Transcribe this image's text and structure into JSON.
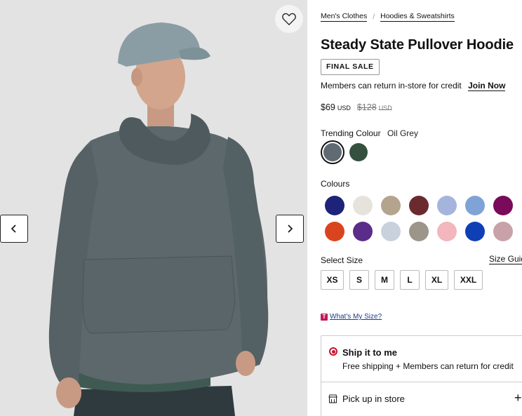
{
  "gallery": {
    "favorite_icon": "heart-outline-icon",
    "prev_icon": "chevron-left-icon",
    "next_icon": "chevron-right-icon"
  },
  "breadcrumb": [
    {
      "label": "Men's Clothes"
    },
    {
      "label": "Hoodies & Sweatshirts"
    }
  ],
  "breadcrumb_separator": "/",
  "product": {
    "title": "Steady State Pullover Hoodie",
    "badge": "FINAL SALE",
    "member_text": "Members can return in-store for credit",
    "join_label": "Join Now",
    "price": "$69",
    "price_currency": "USD",
    "original_price": "$128",
    "original_currency": "USD"
  },
  "trending": {
    "label": "Trending Colour",
    "selected_name": "Oil Grey",
    "swatches": [
      {
        "color": "#5f6a73",
        "selected": true
      },
      {
        "color": "#35503f",
        "selected": false
      }
    ]
  },
  "colours": {
    "label": "Colours",
    "swatches": [
      {
        "color": "#1c2378"
      },
      {
        "color": "#e6e3dc"
      },
      {
        "color": "#b5a48d"
      },
      {
        "color": "#6b2b2e"
      },
      {
        "color": "#a5b4dc"
      },
      {
        "color": "#7fa3d6"
      },
      {
        "color": "#7a0a5a"
      },
      {
        "color": "#d9441f"
      },
      {
        "color": "#5b2d8a"
      },
      {
        "color": "#c9d2dc"
      },
      {
        "color": "#9b958a"
      },
      {
        "color": "#f2b6bc"
      },
      {
        "color": "#0f3fb5"
      },
      {
        "color": "#c9a2a9"
      }
    ]
  },
  "size": {
    "label": "Select Size",
    "guide_label": "Size Guide",
    "options": [
      "XS",
      "S",
      "M",
      "L",
      "XL",
      "XXL"
    ]
  },
  "whats_my_size": {
    "badge_letter": "T",
    "label": "What's My Size?"
  },
  "shipping": {
    "ship_title": "Ship it to me",
    "ship_subtitle": "Free shipping + Members can return for credit",
    "pickup_label": "Pick up in store",
    "pickup_icon": "store-icon",
    "expand_symbol": "+",
    "accent_color": "#c8102e"
  }
}
